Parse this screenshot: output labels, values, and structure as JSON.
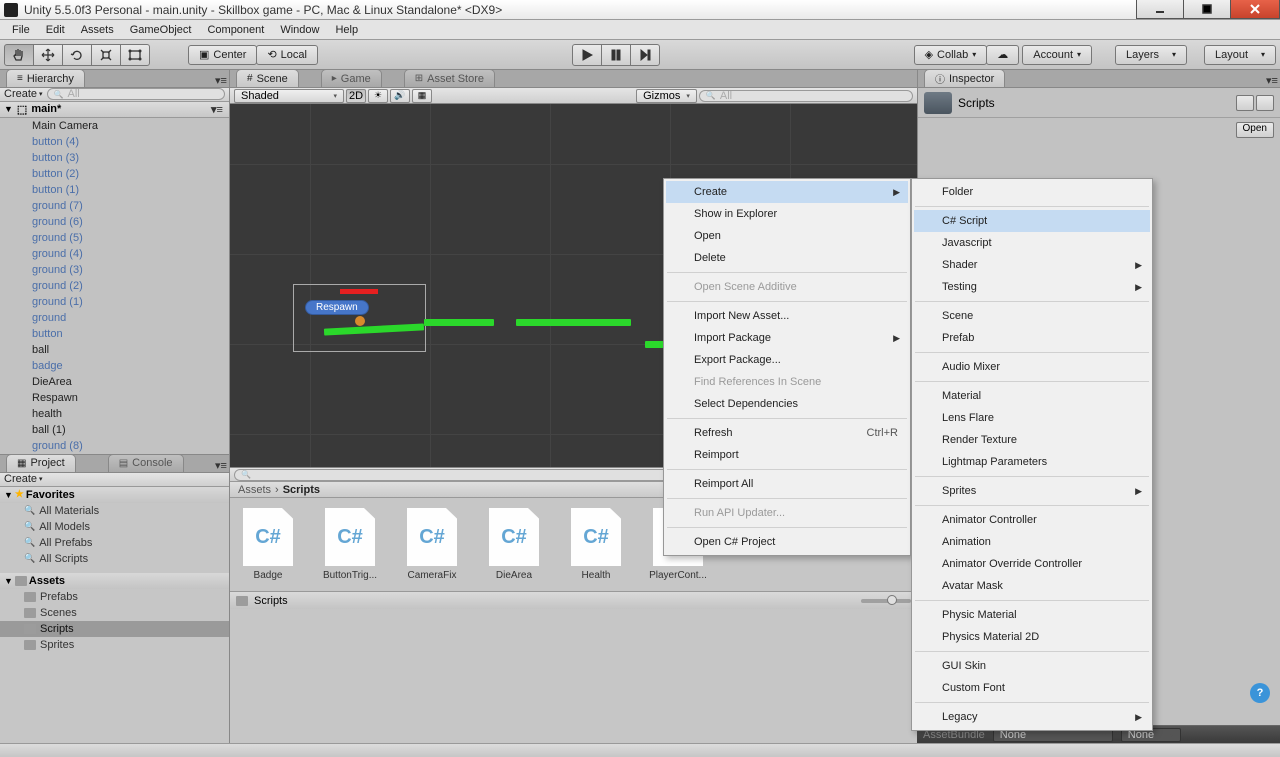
{
  "title": "Unity 5.5.0f3 Personal - main.unity - Skillbox game - PC, Mac & Linux Standalone* <DX9>",
  "menu": [
    "File",
    "Edit",
    "Assets",
    "GameObject",
    "Component",
    "Window",
    "Help"
  ],
  "toolbar": {
    "center": "Center",
    "local": "Local",
    "collab": "Collab",
    "account": "Account",
    "layers": "Layers",
    "layout": "Layout"
  },
  "hierarchy": {
    "tab": "Hierarchy",
    "create": "Create",
    "searchPlaceholder": "All",
    "scene": "main*",
    "items": [
      {
        "t": "Main Camera",
        "c": "black"
      },
      {
        "t": "button (4)"
      },
      {
        "t": "button (3)"
      },
      {
        "t": "button (2)"
      },
      {
        "t": "button (1)"
      },
      {
        "t": "ground (7)"
      },
      {
        "t": "ground (6)"
      },
      {
        "t": "ground (5)"
      },
      {
        "t": "ground (4)"
      },
      {
        "t": "ground (3)"
      },
      {
        "t": "ground (2)"
      },
      {
        "t": "ground (1)"
      },
      {
        "t": "ground"
      },
      {
        "t": "button"
      },
      {
        "t": "ball",
        "c": "black"
      },
      {
        "t": "badge"
      },
      {
        "t": "DieArea",
        "c": "black"
      },
      {
        "t": "Respawn",
        "c": "black"
      },
      {
        "t": "health",
        "c": "black"
      },
      {
        "t": "ball (1)",
        "c": "black"
      },
      {
        "t": "ground (8)"
      }
    ]
  },
  "sceneTabs": {
    "scene": "Scene",
    "game": "Game",
    "asset": "Asset Store"
  },
  "sceneToolbar": {
    "shaded": "Shaded",
    "mode2d": "2D",
    "gizmos": "Gizmos",
    "searchPlaceholder": "All"
  },
  "sceneObj": {
    "respawn": "Respawn"
  },
  "project": {
    "tab": "Project",
    "console": "Console",
    "create": "Create",
    "favorites": "Favorites",
    "favItems": [
      "All Materials",
      "All Models",
      "All Prefabs",
      "All Scripts"
    ],
    "assets": "Assets",
    "assetFolders": [
      "Prefabs",
      "Scenes",
      "Scripts",
      "Sprites"
    ],
    "selectedFolder": "Scripts",
    "breadcrumb": {
      "root": "Assets",
      "sep": "›",
      "cur": "Scripts"
    },
    "scripts": [
      "Badge",
      "ButtonTrig...",
      "CameraFix",
      "DieArea",
      "Health",
      "PlayerCont..."
    ],
    "footer": "Scripts"
  },
  "inspector": {
    "tab": "Inspector",
    "title": "Scripts",
    "open": "Open",
    "none": "None"
  },
  "ctx1": [
    {
      "t": "Create",
      "arrow": true,
      "hl": true
    },
    {
      "t": "Show in Explorer"
    },
    {
      "t": "Open"
    },
    {
      "t": "Delete"
    },
    {
      "sep": true
    },
    {
      "t": "Open Scene Additive",
      "dis": true
    },
    {
      "sep": true
    },
    {
      "t": "Import New Asset..."
    },
    {
      "t": "Import Package",
      "arrow": true
    },
    {
      "t": "Export Package..."
    },
    {
      "t": "Find References In Scene",
      "dis": true
    },
    {
      "t": "Select Dependencies"
    },
    {
      "sep": true
    },
    {
      "t": "Refresh",
      "short": "Ctrl+R"
    },
    {
      "t": "Reimport"
    },
    {
      "sep": true
    },
    {
      "t": "Reimport All"
    },
    {
      "sep": true
    },
    {
      "t": "Run API Updater...",
      "dis": true
    },
    {
      "sep": true
    },
    {
      "t": "Open C# Project"
    }
  ],
  "ctx2": [
    {
      "t": "Folder"
    },
    {
      "sep": true
    },
    {
      "t": "C# Script",
      "hl": true
    },
    {
      "t": "Javascript"
    },
    {
      "t": "Shader",
      "arrow": true
    },
    {
      "t": "Testing",
      "arrow": true
    },
    {
      "sep": true
    },
    {
      "t": "Scene"
    },
    {
      "t": "Prefab"
    },
    {
      "sep": true
    },
    {
      "t": "Audio Mixer"
    },
    {
      "sep": true
    },
    {
      "t": "Material"
    },
    {
      "t": "Lens Flare"
    },
    {
      "t": "Render Texture"
    },
    {
      "t": "Lightmap Parameters"
    },
    {
      "sep": true
    },
    {
      "t": "Sprites",
      "arrow": true
    },
    {
      "sep": true
    },
    {
      "t": "Animator Controller"
    },
    {
      "t": "Animation"
    },
    {
      "t": "Animator Override Controller"
    },
    {
      "t": "Avatar Mask"
    },
    {
      "sep": true
    },
    {
      "t": "Physic Material"
    },
    {
      "t": "Physics Material 2D"
    },
    {
      "sep": true
    },
    {
      "t": "GUI Skin"
    },
    {
      "t": "Custom Font"
    },
    {
      "sep": true
    },
    {
      "t": "Legacy",
      "arrow": true
    }
  ]
}
